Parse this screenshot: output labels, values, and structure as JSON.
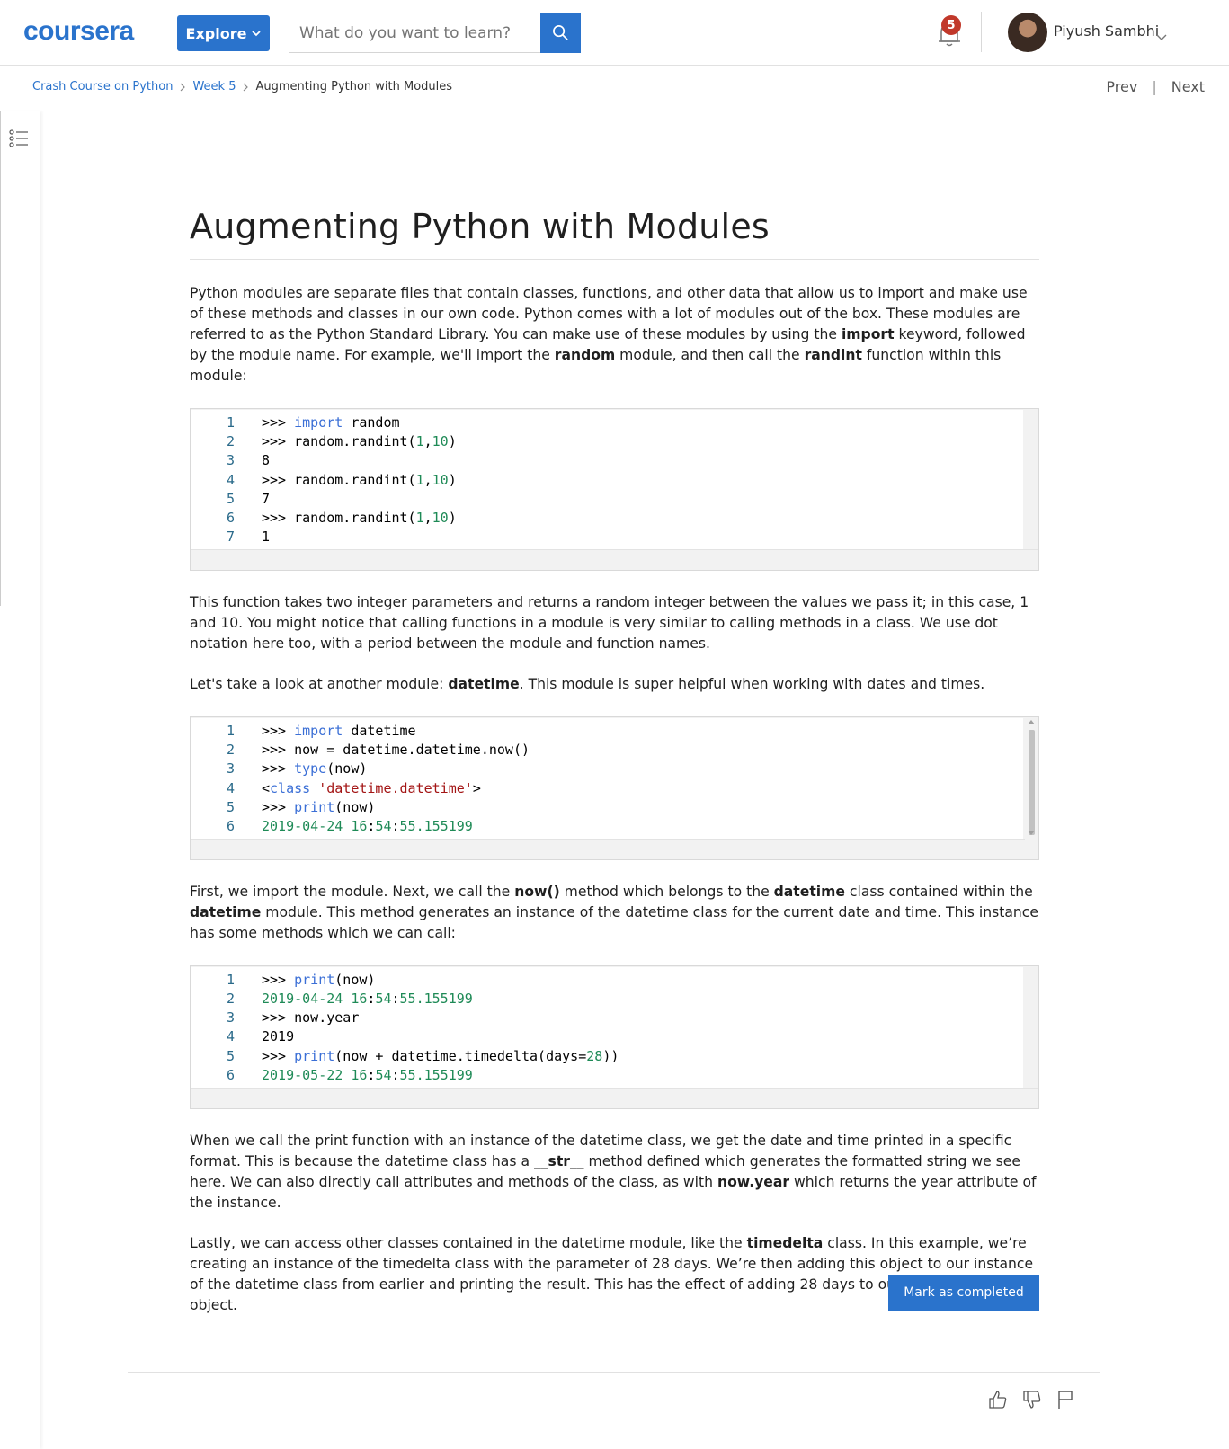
{
  "header": {
    "logo_text": "coursera",
    "explore_label": "Explore",
    "search_placeholder": "What do you want to learn?",
    "notification_count": "5",
    "user_name": "Piyush Sambhi"
  },
  "breadcrumb": {
    "items": [
      "Crash Course on Python",
      "Week 5",
      "Augmenting Python with Modules"
    ],
    "prev_label": "Prev",
    "separator": "|",
    "next_label": "Next"
  },
  "content": {
    "title": "Augmenting Python with Modules",
    "p1": {
      "a": "Python modules are separate files that contain classes, functions, and other data that allow us to import and make use of these methods and classes in our own code. Python comes with a lot of modules out of the box. These modules are referred to as the Python Standard Library. You can make use of these modules by using the ",
      "b1": "import",
      "c": " keyword, followed by the module name. For example, we'll import the ",
      "b2": "random",
      "d": " module, and then call the ",
      "b3": "randint",
      "e": " function within this module:"
    },
    "code1": [
      [
        "1",
        ">>> ",
        "import",
        " random"
      ],
      [
        "2",
        ">>> random.randint(",
        "1",
        ",",
        "10",
        ")"
      ],
      [
        "3",
        "8"
      ],
      [
        "4",
        ">>> random.randint(",
        "1",
        ",",
        "10",
        ")"
      ],
      [
        "5",
        "7"
      ],
      [
        "6",
        ">>> random.randint(",
        "1",
        ",",
        "10",
        ")"
      ],
      [
        "7",
        "1"
      ]
    ],
    "p2": "This function takes two integer parameters and returns a random integer between the values we pass it; in this case, 1 and 10. You might notice that calling functions in a module is very similar to calling methods in a class. We use dot notation here too, with a period between the module and function names.",
    "p3": {
      "a": "Let's take a look at another module: ",
      "b1": "datetime",
      "c": ". This module is super helpful when working with dates and times."
    },
    "code2": {
      "l1": {
        "n": "1",
        "a": ">>> ",
        "kw": "import",
        "b": " datetime"
      },
      "l2": {
        "n": "2",
        "a": ">>> now = datetime.datetime.now()"
      },
      "l3": {
        "n": "3",
        "a": ">>> ",
        "kw": "type",
        "b": "(now)"
      },
      "l4": {
        "n": "4",
        "a": "<",
        "kw": "class",
        "sp": " ",
        "str": "'datetime.datetime'",
        "b": ">"
      },
      "l5": {
        "n": "5",
        "a": ">>> ",
        "kw": "print",
        "b": "(now)"
      },
      "l6": {
        "n": "6",
        "d1": "2019-04-24 16",
        "c1": ":",
        "d2": "54",
        "c2": ":",
        "d3": "55.155199"
      }
    },
    "p4": {
      "a": "First, we import the module. Next, we call the ",
      "b1": "now()",
      "c": " method which belongs to the ",
      "b2": "datetime",
      "d": " class contained within the ",
      "b3": "datetime",
      "e": " module. This method generates an instance of the datetime class for the current date and time. This instance has some methods which we can call:"
    },
    "code3": {
      "l1": {
        "n": "1",
        "a": ">>> ",
        "kw": "print",
        "b": "(now)"
      },
      "l2": {
        "n": "2",
        "d1": "2019-04-24 16",
        "c1": ":",
        "d2": "54",
        "c2": ":",
        "d3": "55.155199"
      },
      "l3": {
        "n": "3",
        "a": ">>> now.year"
      },
      "l4": {
        "n": "4",
        "d1": "2019"
      },
      "l5": {
        "n": "5",
        "a": ">>> ",
        "kw": "print",
        "b": "(now + datetime.timedelta(days=",
        "num": "28",
        "c": "))"
      },
      "l6": {
        "n": "6",
        "d1": "2019-05-22 16",
        "c1": ":",
        "d2": "54",
        "c2": ":",
        "d3": "55.155199"
      }
    },
    "p5": {
      "a": "When we call the print function with an instance of the datetime class, we get the date and time printed in a specific format. This is because the datetime class has a ",
      "b1": "__str__",
      "c": " method defined which generates the formatted string we see here. We can also directly call attributes and methods of the class, as with ",
      "b2": "now.year",
      "d": " which returns the year attribute of the instance."
    },
    "p6": {
      "a": "Lastly, we can access other classes contained in the datetime module, like the ",
      "b1": "timedelta",
      "c": " class. In this example, we’re creating an instance of the timedelta class with the parameter of 28 days. We’re then adding this object to our instance of the datetime class from earlier and printing the result. This has the effect of adding 28 days to our original datetime object."
    },
    "mark_completed_label": "Mark as completed"
  },
  "colors": {
    "brand_blue": "#2a73cc",
    "badge_red": "#c1382a",
    "keyword_blue": "#3b6fd6",
    "number_green": "#1e8a56",
    "string_red": "#a31515"
  },
  "icons": [
    "search-icon",
    "bell-icon",
    "chevron-down-icon",
    "chevron-right-icon",
    "list-icon",
    "thumbs-up-icon",
    "thumbs-down-icon",
    "flag-icon"
  ]
}
